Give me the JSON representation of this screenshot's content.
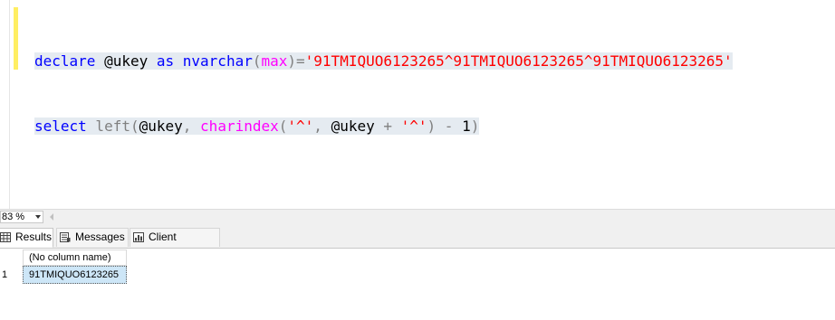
{
  "editor": {
    "line1": {
      "kw_declare": "declare",
      "var_ukey": " @ukey ",
      "kw_as": "as",
      "kw_nvarchar": " nvarchar",
      "paren_open": "(",
      "kw_max": "max",
      "paren_close_eq": ")=",
      "string": "'91TMIQUO6123265^91TMIQUO6123265^91TMIQUO6123265'"
    },
    "line2": {
      "kw_select": "select",
      "fn_left": " left",
      "paren_open": "(",
      "var_ukey": "@ukey",
      "comma": ", ",
      "fn_charindex": "charindex",
      "paren_open2": "(",
      "str_caret": "'^'",
      "comma2": ", ",
      "var_ukey2": "@ukey ",
      "plus": "+ ",
      "str_caret2": "'^'",
      "paren_close": ") - ",
      "num_one": "1",
      "paren_close2": ")"
    }
  },
  "zoom": {
    "value": "83 %"
  },
  "tabs": [
    {
      "label": "Results",
      "icon": "grid-icon"
    },
    {
      "label": "Messages",
      "icon": "messages-icon"
    },
    {
      "label": "Client Statistics",
      "icon": "statistics-icon"
    }
  ],
  "grid": {
    "column_header": "(No column name)",
    "rows": [
      {
        "row_number": "1",
        "value": "91TMIQUO6123265"
      }
    ]
  },
  "colors": {
    "keyword": "#0000ff",
    "function": "#ff00ff",
    "string": "#ff0000",
    "operator": "#808080",
    "selection": "#e5ebf1",
    "change_marker": "#ffee62",
    "selected_cell": "#cde6f7"
  }
}
